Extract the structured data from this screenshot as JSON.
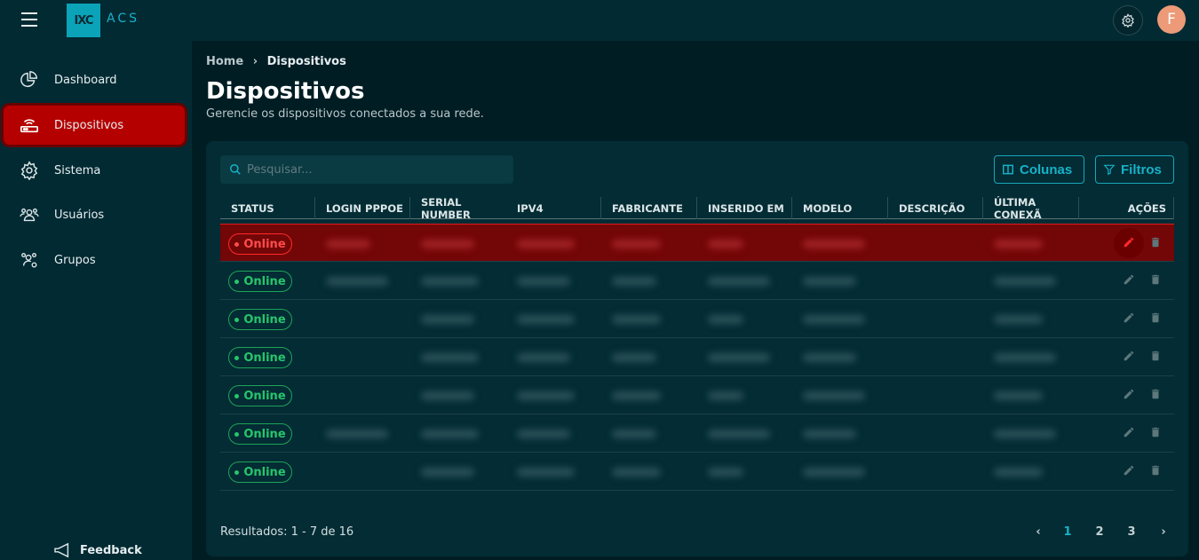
{
  "header": {
    "logo_text": "IXC",
    "product": "ACS",
    "avatar_initial": "F",
    "icons": [
      "menu-icon",
      "gear-icon"
    ]
  },
  "sidebar": {
    "items": [
      {
        "label": "Dashboard",
        "icon": "pie-chart-icon"
      },
      {
        "label": "Dispositivos",
        "icon": "router-icon",
        "active": true
      },
      {
        "label": "Sistema",
        "icon": "gear-icon"
      },
      {
        "label": "Usuários",
        "icon": "users-icon"
      },
      {
        "label": "Grupos",
        "icon": "users-gear-icon"
      }
    ],
    "feedback": "Feedback"
  },
  "breadcrumb": {
    "home": "Home",
    "current": "Dispositivos"
  },
  "page": {
    "title": "Dispositivos",
    "subtitle": "Gerencie os dispositivos conectados a sua rede."
  },
  "toolbar": {
    "search_placeholder": "Pesquisar...",
    "columns_label": "Colunas",
    "filters_label": "Filtros"
  },
  "table": {
    "headers": [
      "STATUS",
      "LOGIN PPPOE",
      "SERIAL NUMBER",
      "IPV4",
      "FABRICANTE",
      "INSERIDO EM",
      "MODELO",
      "DESCRIÇÃO",
      "ÚLTIMA CONEXÃ",
      "AÇÕES"
    ],
    "rows": [
      {
        "status": "Online"
      },
      {
        "status": "Online"
      },
      {
        "status": "Online"
      },
      {
        "status": "Online"
      },
      {
        "status": "Online"
      },
      {
        "status": "Online"
      },
      {
        "status": "Online"
      }
    ]
  },
  "footer": {
    "results": "Resultados: 1 - 7 de 16",
    "pages": [
      "1",
      "2",
      "3"
    ],
    "current_page": "1",
    "prev": "‹",
    "next": "›"
  },
  "colors": {
    "accent": "#17b2c8",
    "active_nav": "#b50000",
    "online": "#27c56b",
    "selected_row": "#730607"
  }
}
